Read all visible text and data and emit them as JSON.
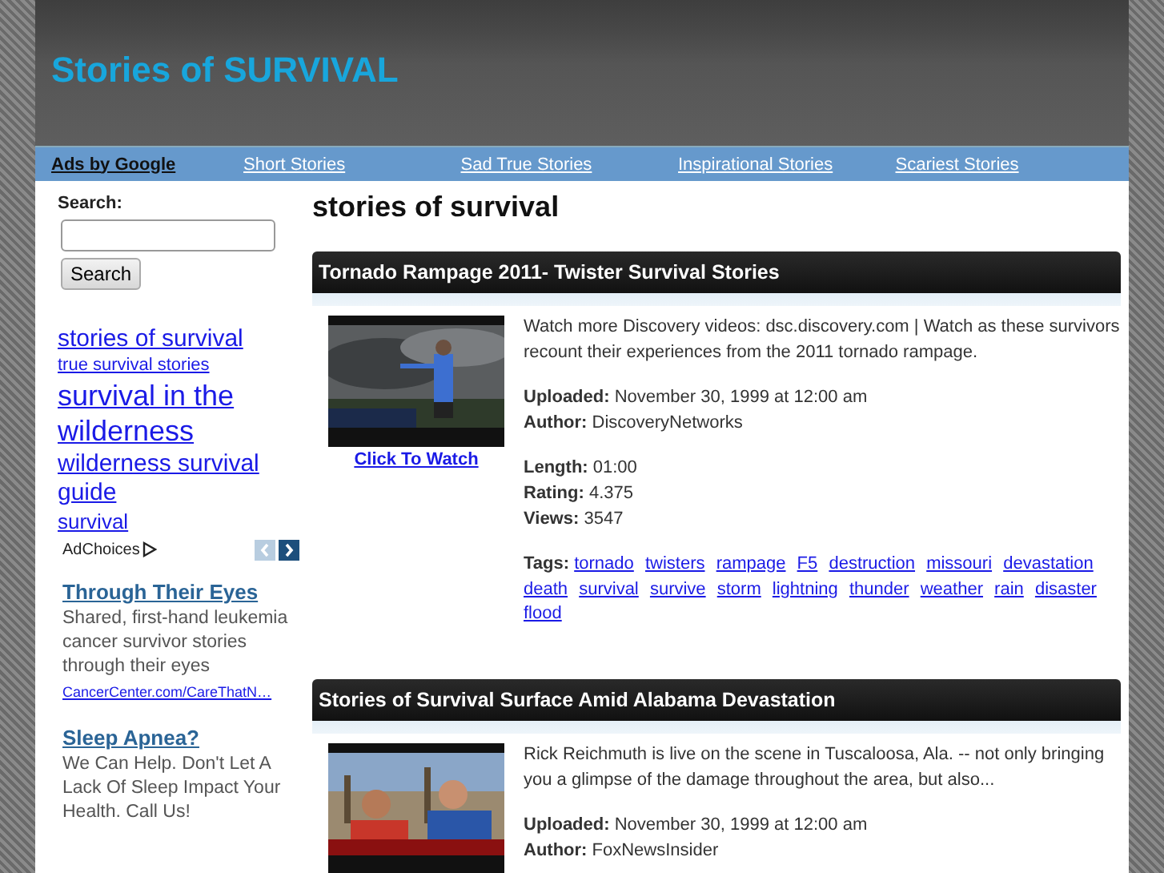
{
  "site_title": "Stories of SURVIVAL",
  "nav": [
    {
      "label": "Ads by Google",
      "kind": "ads"
    },
    {
      "label": "Short Stories",
      "kind": "link"
    },
    {
      "label": "Sad True Stories",
      "kind": "link"
    },
    {
      "label": "Inspirational Stories",
      "kind": "link"
    },
    {
      "label": "Scariest Stories",
      "kind": "link"
    }
  ],
  "sidebar": {
    "search_label": "Search:",
    "search_button": "Search",
    "keywords": [
      {
        "text": "stories of survival",
        "kind": "large"
      },
      {
        "text": "true survival stories",
        "kind": "small"
      },
      {
        "text": "survival in the wilderness",
        "kind": "huge"
      },
      {
        "text": "wilderness survival guide",
        "kind": "large"
      },
      {
        "text": "survival",
        "kind": "medium"
      }
    ],
    "adchoices": "AdChoices",
    "ads": [
      {
        "title": "Through Their Eyes",
        "text": "Shared, first-hand leukemia cancer survivor stories through their eyes",
        "url": "CancerCenter.com/CareThatN…"
      },
      {
        "title": "Sleep Apnea?",
        "text": "We Can Help. Don't Let A Lack Of Sleep Impact Your Health. Call Us!"
      }
    ]
  },
  "page_heading": "stories of survival",
  "videos": [
    {
      "title": "Tornado Rampage 2011- Twister Survival Stories",
      "watch_link": "Click To Watch",
      "description": "Watch more Discovery videos: dsc.discovery.com | Watch as these survivors recount their experiences from the 2011 tornado rampage.",
      "meta_groups": [
        [
          "**Uploaded:** November 30, 1999 at 12:00 am",
          "**Author:** DiscoveryNetworks"
        ],
        [
          "**Length:** 01:00",
          "**Rating:** 4.375",
          "**Views:** 3547"
        ]
      ],
      "tags_label": "Tags:",
      "tags": [
        "tornado",
        "twisters",
        "rampage",
        "F5",
        "destruction",
        "missouri",
        "devastation",
        "death",
        "survival",
        "survive",
        "storm",
        "lightning",
        "thunder",
        "weather",
        "rain",
        "disaster",
        "flood"
      ]
    },
    {
      "title": "Stories of Survival Surface Amid Alabama Devastation",
      "description": "Rick Reichmuth is live on the scene in Tuscaloosa, Ala. -- not only bringing you a glimpse of the damage throughout the area, but also...",
      "meta_groups": [
        [
          "**Uploaded:** November 30, 1999 at 12:00 am",
          "**Author:** FoxNewsInsider"
        ]
      ]
    }
  ]
}
